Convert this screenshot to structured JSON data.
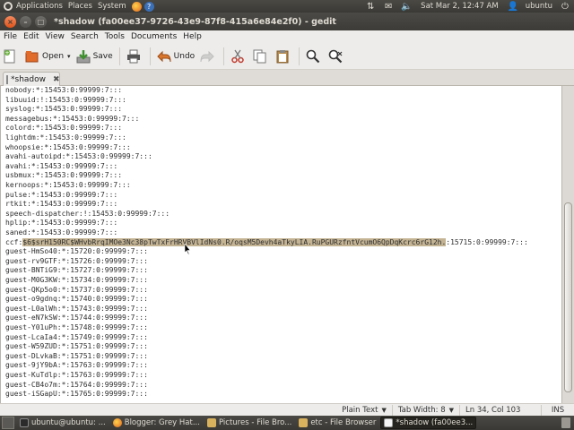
{
  "top_panel": {
    "menus": [
      "Applications",
      "Places",
      "System"
    ],
    "clock": "Sat Mar 2, 12:47 AM",
    "user": "ubuntu"
  },
  "window": {
    "title": "*shadow (fa00ee37-9726-43e9-87f8-415a6e84e2f0) - gedit"
  },
  "menubar": [
    "File",
    "Edit",
    "View",
    "Search",
    "Tools",
    "Documents",
    "Help"
  ],
  "toolbar": {
    "open_label": "Open",
    "save_label": "Save",
    "undo_label": "Undo"
  },
  "tab": {
    "label": "*shadow"
  },
  "editor": {
    "lines": [
      "nobody:*:15453:0:99999:7:::",
      "libuuid:!:15453:0:99999:7:::",
      "syslog:*:15453:0:99999:7:::",
      "messagebus:*:15453:0:99999:7:::",
      "colord:*:15453:0:99999:7:::",
      "lightdm:*:15453:0:99999:7:::",
      "whoopsie:*:15453:0:99999:7:::",
      "avahi-autoipd:*:15453:0:99999:7:::",
      "avahi:*:15453:0:99999:7:::",
      "usbmux:*:15453:0:99999:7:::",
      "kernoops:*:15453:0:99999:7:::",
      "pulse:*:15453:0:99999:7:::",
      "rtkit:*:15453:0:99999:7:::",
      "speech-dispatcher:!:15453:0:99999:7:::",
      "hplip:*:15453:0:99999:7:::",
      "saned:*:15453:0:99999:7:::",
      "ccf:$6$srH150RC$WHvbRrqIMOe3Nc38pTwTxFrHRVBVlIdNs0.R/oqsM5Devh4aTkyLIA.RuPGURzfntVcumO6QpDqKcrc6rG12h.:15715:0:99999:7:::",
      "guest-HmSo40:*:15720:0:99999:7:::",
      "guest-rv9GTF:*:15726:0:99999:7:::",
      "guest-BNTiG9:*:15727:0:99999:7:::",
      "guest-M0G3KW:*:15734:0:99999:7:::",
      "guest-QKp5o0:*:15737:0:99999:7:::",
      "guest-o9gdnq:*:15740:0:99999:7:::",
      "guest-L0alWh:*:15743:0:99999:7:::",
      "guest-eN7kSW:*:15744:0:99999:7:::",
      "guest-Y01uPh:*:15748:0:99999:7:::",
      "guest-LcaIa4:*:15749:0:99999:7:::",
      "guest-W59ZUD:*:15751:0:99999:7:::",
      "guest-DLvkaB:*:15751:0:99999:7:::",
      "guest-9jY9bA:*:15763:0:99999:7:::",
      "guest-KuTdlp:*:15763:0:99999:7:::",
      "guest-CB4o7m:*:15764:0:99999:7:::",
      "guest-iSGapU:*:15765:0:99999:7:::"
    ],
    "highlight": {
      "line_index": 16,
      "before": "ccf:",
      "selected": "$6$srH150RC$WHvbRrqIMOe3Nc38pTwTxFrHRVBVlIdNs0.R/oqsM5Devh4aTkyLIA.RuPGURzfntVcumO6QpDqKcrc6rG12h.",
      "after": ":15715:0:99999:7:::"
    }
  },
  "statusbar": {
    "language": "Plain Text",
    "tab_width": "Tab Width:  8",
    "position": "Ln 34, Col 103",
    "mode": "INS"
  },
  "taskbar": {
    "tasks": [
      "ubuntu@ubuntu: ...",
      "Blogger: Grey Hat...",
      "Pictures - File Bro...",
      "etc - File Browser",
      "*shadow (fa00ee3..."
    ]
  },
  "colors": {
    "selection": "#c4b494",
    "panel": "#3c3b37",
    "close_button": "#e0531a"
  }
}
